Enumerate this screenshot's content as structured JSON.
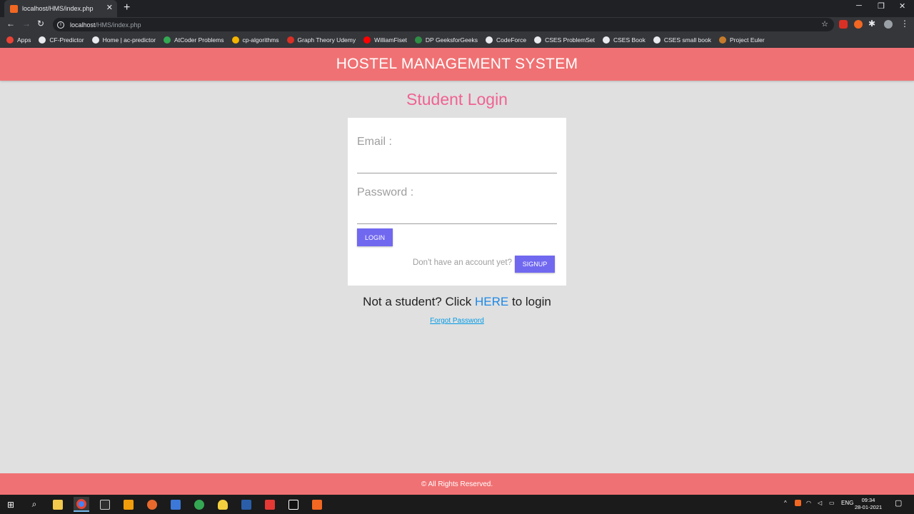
{
  "browser": {
    "tab_title": "localhost/HMS/index.php",
    "url_host": "localhost",
    "url_path": "/HMS/index.php",
    "bookmarks": [
      {
        "label": "Apps",
        "color": "#ea4335"
      },
      {
        "label": "CF-Predictor",
        "color": "#e8eaed"
      },
      {
        "label": "Home | ac-predictor",
        "color": "#e8eaed"
      },
      {
        "label": "AtCoder Problems",
        "color": "#34a853"
      },
      {
        "label": "cp-algorithms",
        "color": "#f4b400"
      },
      {
        "label": "Graph Theory Udemy",
        "color": "#d93025"
      },
      {
        "label": "WilliamFiset",
        "color": "#ff0000"
      },
      {
        "label": "DP GeeksforGeeks",
        "color": "#2f8d46"
      },
      {
        "label": "CodeForce",
        "color": "#e8eaed"
      },
      {
        "label": "CSES ProblemSet",
        "color": "#e8eaed"
      },
      {
        "label": "CSES Book",
        "color": "#e8eaed"
      },
      {
        "label": "CSES small book",
        "color": "#e8eaed"
      },
      {
        "label": "Project Euler",
        "color": "#c57b2b"
      }
    ]
  },
  "header": {
    "title": "HOSTEL MANAGEMENT SYSTEM"
  },
  "login": {
    "title": "Student Login",
    "email_label": "Email :",
    "password_label": "Password :",
    "email_value": "",
    "password_value": "",
    "login_button": "LOGIN",
    "no_account_text": "Don't have an account yet?",
    "signup_button": "SIGNUP"
  },
  "alt_login": {
    "prefix": "Not a student? Click ",
    "link": "HERE",
    "suffix": " to login"
  },
  "forgot_password": "Forgot Password",
  "footer": {
    "text": "© All Rights Reserved."
  },
  "taskbar": {
    "language": "ENG",
    "time": "09:34",
    "date": "28-01-2021"
  },
  "colors": {
    "header_bg": "#f07173",
    "title_pink": "#f06292",
    "button": "#7168f0",
    "link_blue": "#1e88e5"
  }
}
